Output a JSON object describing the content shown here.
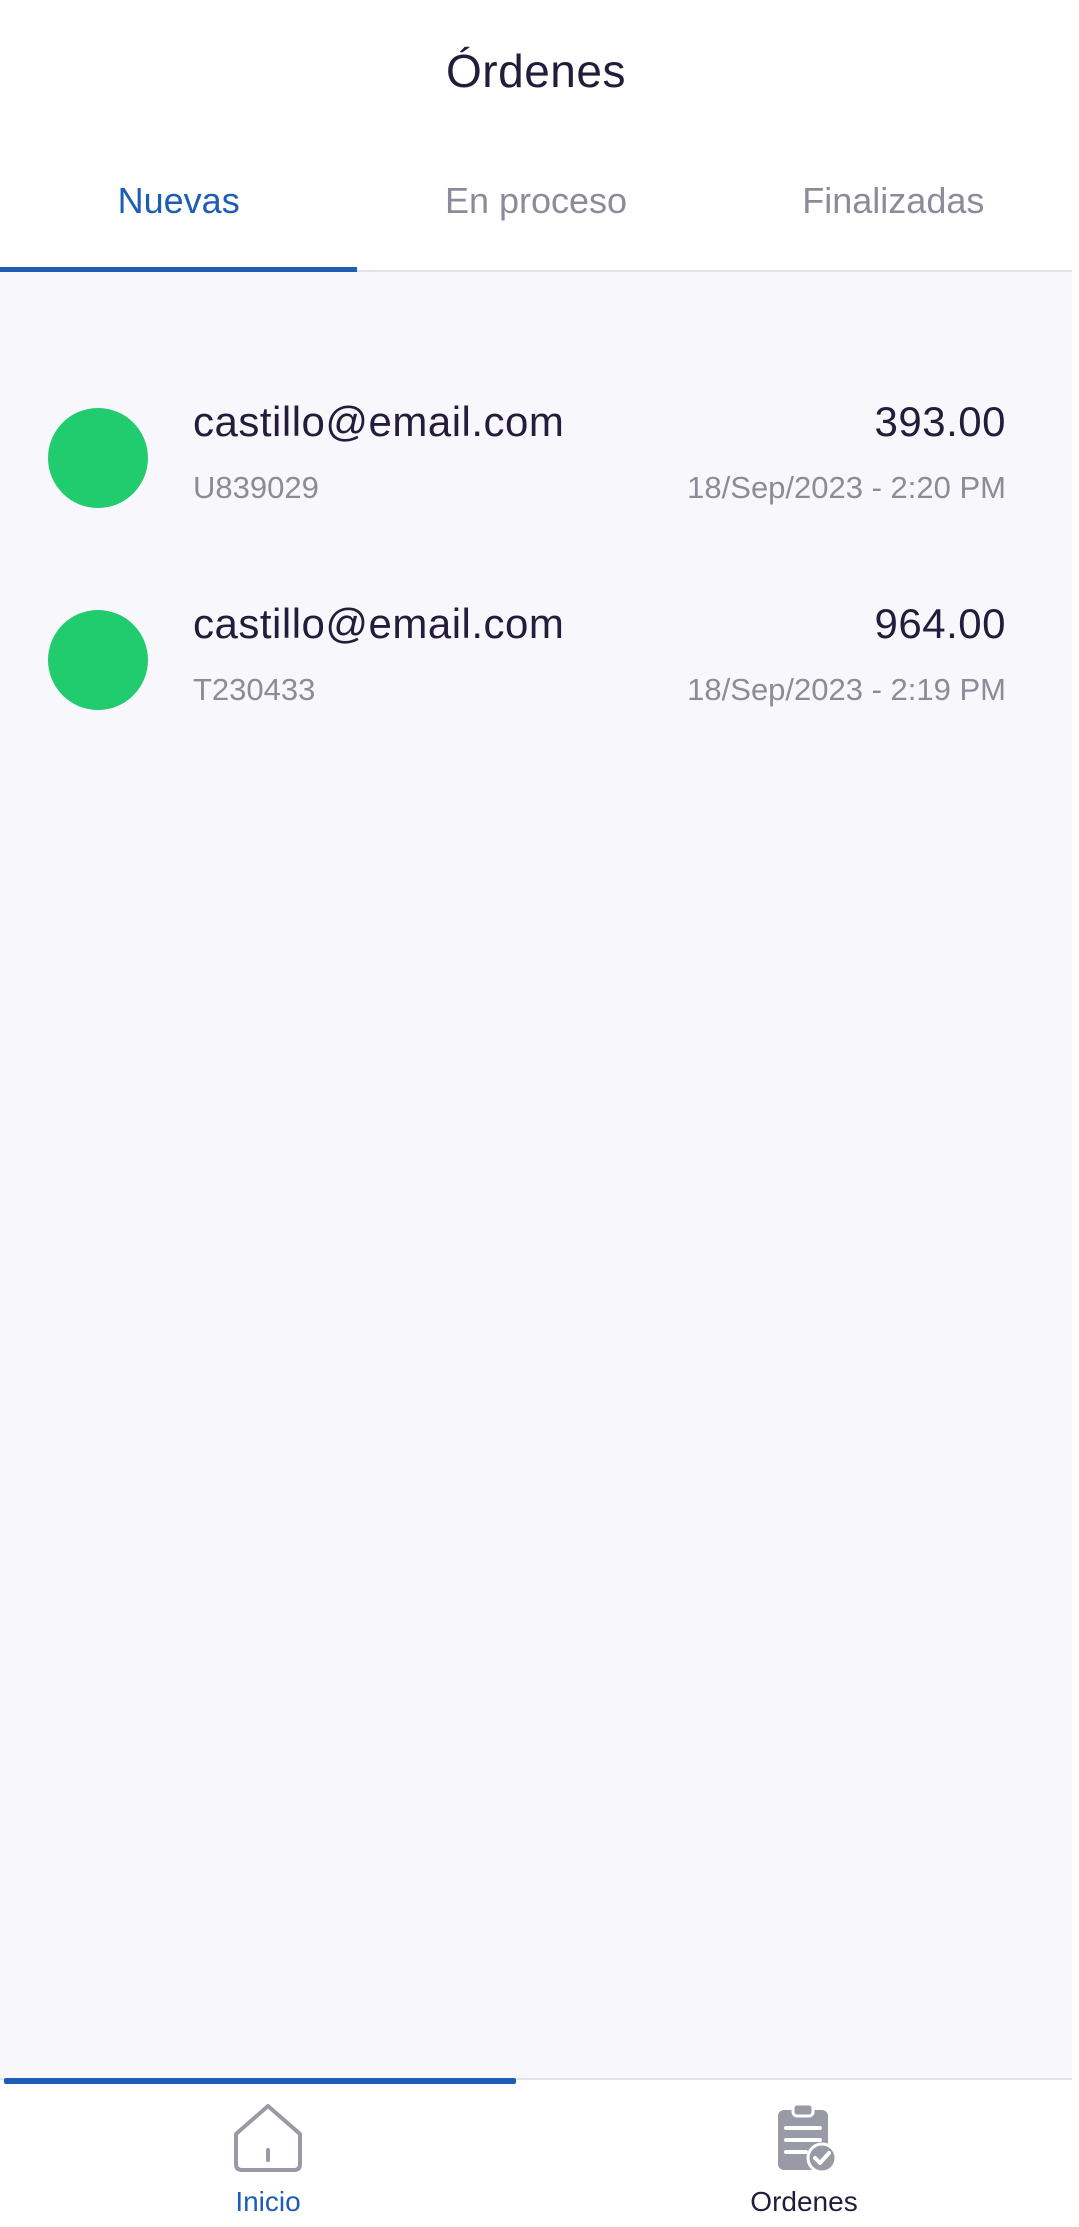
{
  "header": {
    "title": "Órdenes"
  },
  "tabs": [
    {
      "label": "Nuevas",
      "active": true
    },
    {
      "label": "En proceso",
      "active": false
    },
    {
      "label": "Finalizadas",
      "active": false
    }
  ],
  "orders": [
    {
      "email": "castillo@email.com",
      "id": "U839029",
      "amount": "393.00",
      "date": "18/Sep/2023 - 2:20 PM",
      "status_color": "#21cc6e"
    },
    {
      "email": "castillo@email.com",
      "id": "T230433",
      "amount": "964.00",
      "date": "18/Sep/2023 - 2:19 PM",
      "status_color": "#21cc6e"
    }
  ],
  "bottom_nav": {
    "items": [
      {
        "label": "Inicio",
        "icon": "home-icon",
        "active": true
      },
      {
        "label": "Ordenes",
        "icon": "clipboard-check-icon",
        "active": false
      }
    ]
  },
  "colors": {
    "accent": "#1d5db3",
    "status_new": "#21cc6e",
    "text_primary": "#241c3b",
    "text_secondary": "#8e8b99",
    "list_background": "#f8f7fc"
  }
}
